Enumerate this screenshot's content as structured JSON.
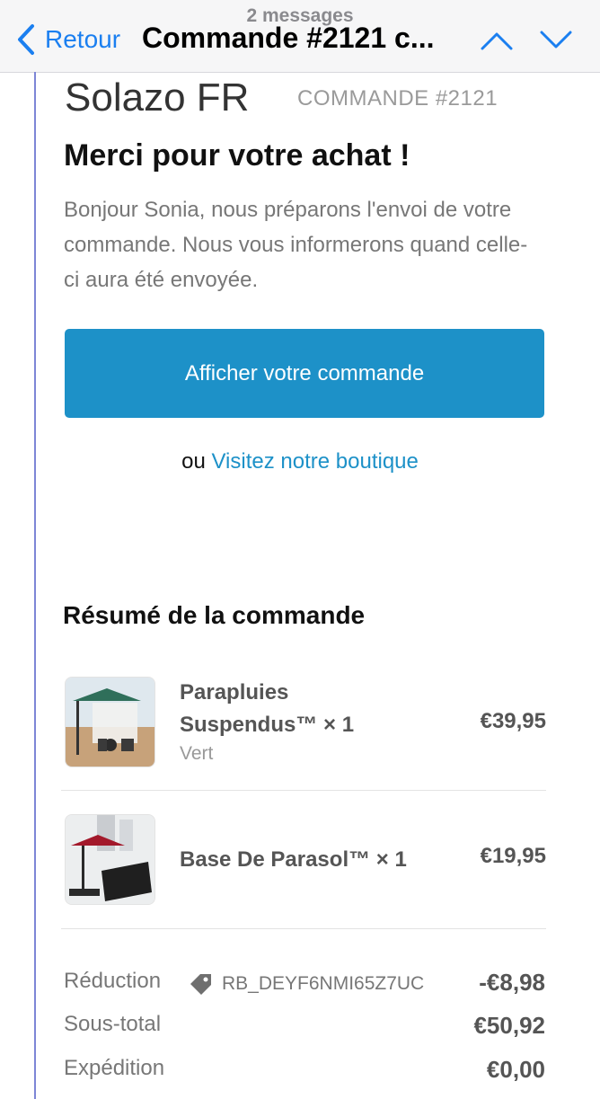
{
  "nav": {
    "messages_count": "2 messages",
    "back_label": "Retour",
    "title": "Commande #2121 c..."
  },
  "email": {
    "shop_name": "Solazo FR",
    "order_number": "COMMANDE #2121",
    "thanks_title": "Merci pour votre achat !",
    "intro_text": "Bonjour Sonia, nous préparons l'envoi de votre commande. Nous vous informerons quand celle-ci aura été envoyée.",
    "view_order_button": "Afficher votre commande",
    "or_word": "ou",
    "shop_link": "Visitez notre boutique"
  },
  "summary": {
    "title": "Résumé de la commande",
    "items": [
      {
        "name_line1": "Parapluies",
        "name_line2": "Suspendus™ × 1",
        "variant": "Vert",
        "price": "€39,95"
      },
      {
        "name": "Base De Parasol™ × 1",
        "price": "€19,95"
      }
    ],
    "totals": {
      "discount_label": "Réduction",
      "discount_code": "RB_DEYF6NMI65Z7UC",
      "discount_value": "-€8,98",
      "subtotal_label": "Sous-total",
      "subtotal_value": "€50,92",
      "shipping_label": "Expédition",
      "shipping_value": "€0,00"
    }
  },
  "colors": {
    "accent": "#1d91c8",
    "ios_blue": "#1b7ff0",
    "thread_line": "#7d86d6"
  }
}
